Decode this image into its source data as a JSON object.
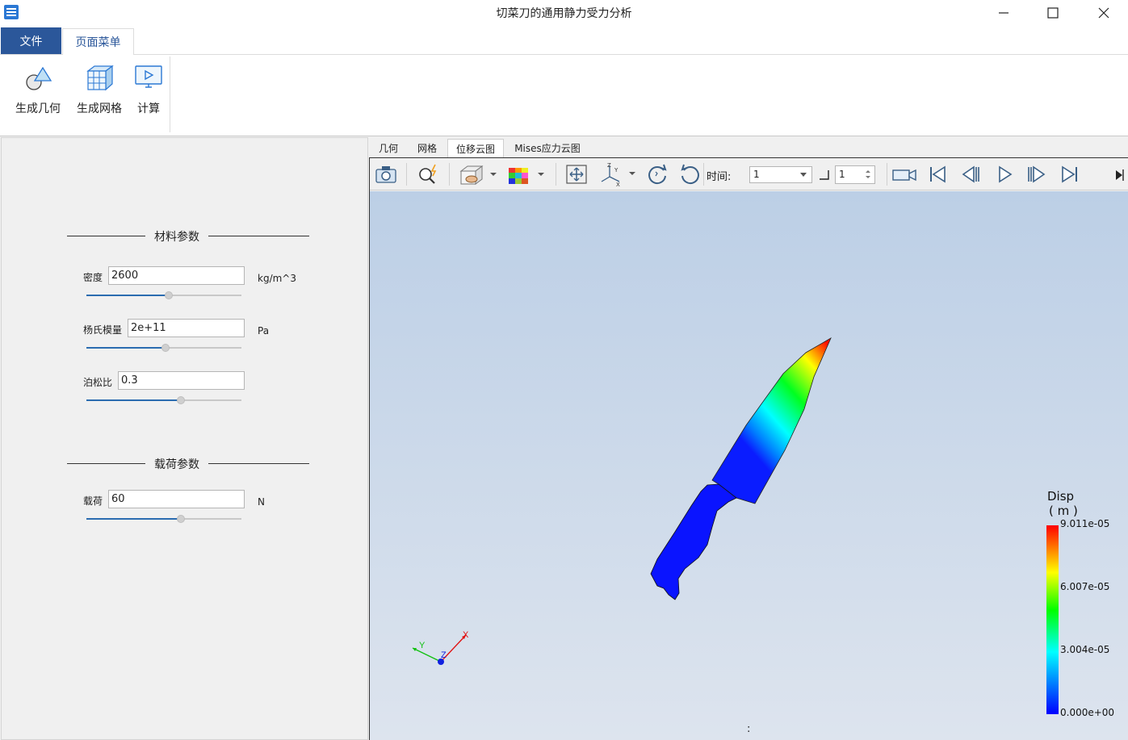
{
  "window": {
    "title": "切菜刀的通用静力受力分析"
  },
  "menu": {
    "tabs": [
      {
        "label": "文件"
      },
      {
        "label": "页面菜单"
      }
    ]
  },
  "ribbon": {
    "buttons": [
      {
        "label": "生成几何",
        "icon": "geometry-icon"
      },
      {
        "label": "生成网格",
        "icon": "mesh-icon"
      },
      {
        "label": "计算",
        "icon": "compute-icon"
      }
    ]
  },
  "material": {
    "title": "材料参数",
    "density": {
      "label": "密度",
      "value": "2600",
      "unit": "kg/m^3",
      "slider": 0.53
    },
    "youngs": {
      "label": "杨氏模量",
      "value": "2e+11",
      "unit": "Pa",
      "slider": 0.51
    },
    "poisson": {
      "label": "泊松比",
      "value": "0.3",
      "slider": 0.61
    }
  },
  "load": {
    "title": "载荷参数",
    "force": {
      "label": "载荷",
      "value": "60",
      "unit": "N",
      "slider": 0.61
    }
  },
  "view_tabs": [
    {
      "label": "几何"
    },
    {
      "label": "网格"
    },
    {
      "label": "位移云图"
    },
    {
      "label": "Mises应力云图"
    }
  ],
  "toolbar": {
    "time_label": "时间:",
    "time_value": "1",
    "step_value": "1"
  },
  "legend": {
    "title": "Disp",
    "unit": "( m )",
    "ticks": [
      "9.011e-05",
      "6.007e-05",
      "3.004e-05",
      "0.000e+00"
    ],
    "colors": [
      "#0000ff",
      "#00ffff",
      "#00ff00",
      "#ffff00",
      "#ff0000"
    ]
  },
  "axes": {
    "x": "X",
    "y": "Y",
    "z": "Z"
  },
  "status": {
    "text": ":"
  }
}
